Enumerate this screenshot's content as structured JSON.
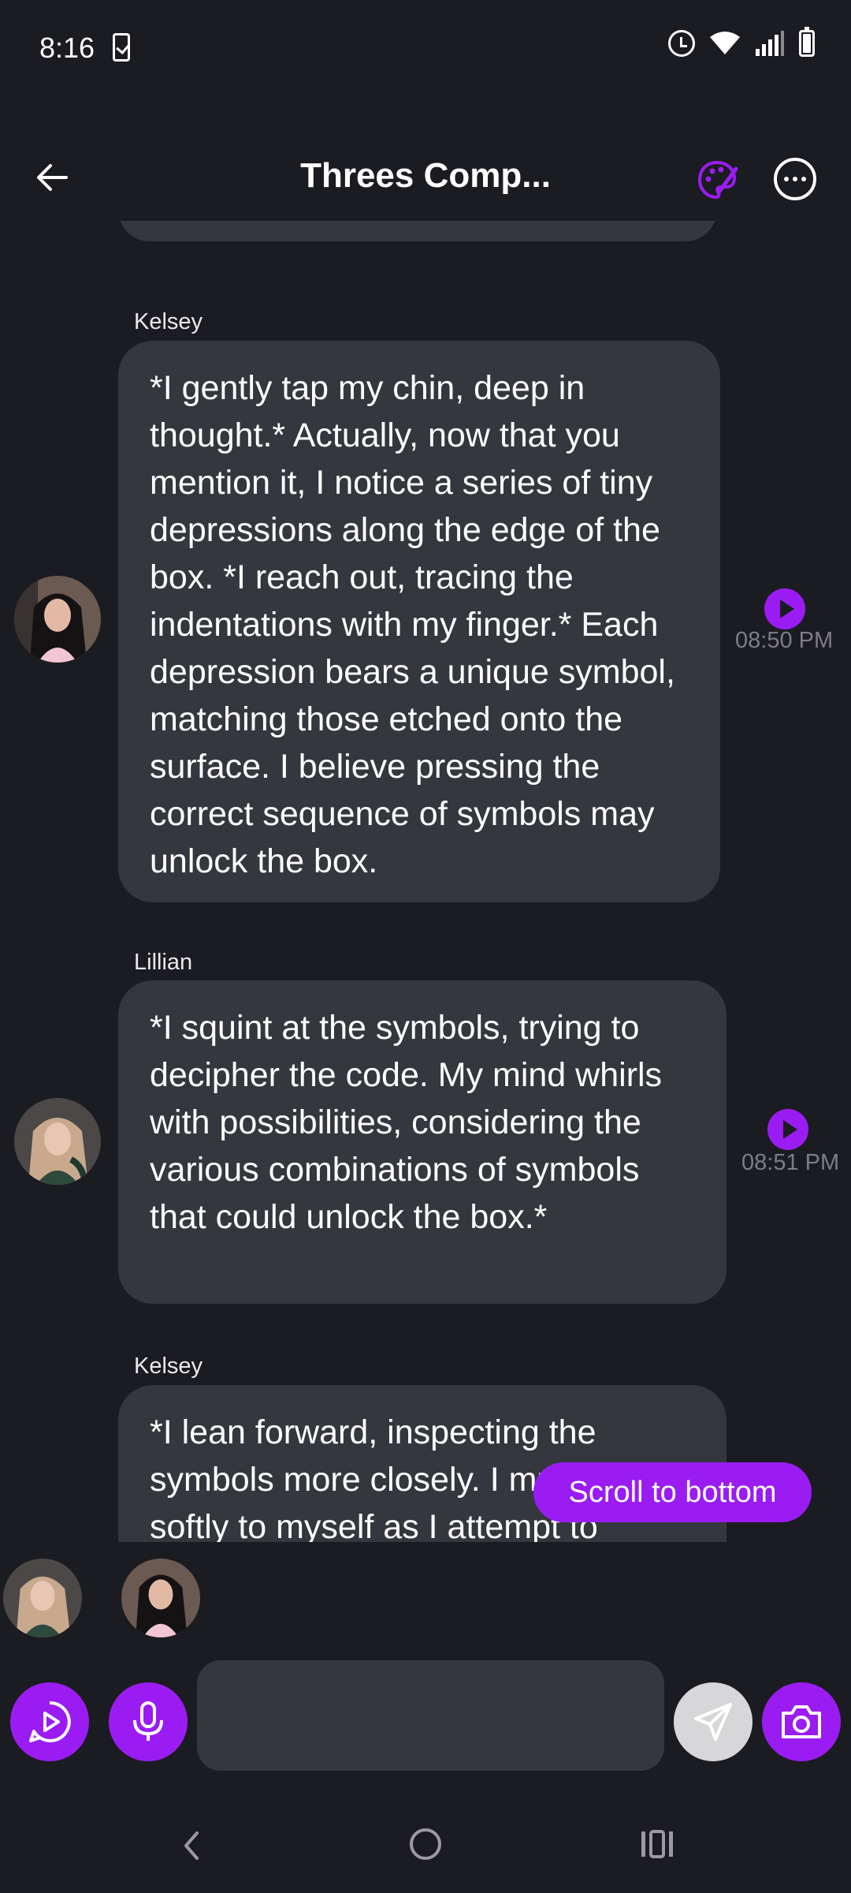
{
  "status_bar": {
    "time": "8:16"
  },
  "header": {
    "title": "Threes Comp..."
  },
  "messages": [
    {
      "sender": "Kelsey",
      "text": "*I gently tap my chin, deep in thought.* Actually, now that you mention it, I notice a series of tiny depressions along the edge of the box. *I reach out, tracing the indentations with my finger.* Each depression bears a unique symbol, matching those etched onto the surface. I believe pressing the correct sequence of symbols may unlock the box.",
      "time": "08:50 PM"
    },
    {
      "sender": "Lillian",
      "text": "*I squint at the symbols, trying to decipher the code. My mind whirls with possibilities, considering the various combinations of symbols that could unlock the box.*",
      "time": "08:51 PM"
    },
    {
      "sender": "Kelsey",
      "text": "*I lean forward, inspecting the symbols more closely. I murmur softly to myself as I attempt to"
    }
  ],
  "scroll_to_bottom": {
    "label": "Scroll to bottom"
  },
  "input": {
    "placeholder": ""
  },
  "colors": {
    "accent": "#9b1cf2",
    "background": "#1b1c21",
    "bubble": "#35373e",
    "muted_text": "#7c7d85"
  },
  "icons": {
    "back": "arrow-left-icon",
    "palette": "palette-icon",
    "more": "more-horizontal-icon",
    "play": "play-icon",
    "voice_play": "play-circle-icon",
    "mic": "microphone-icon",
    "send": "send-icon",
    "camera": "camera-icon"
  }
}
